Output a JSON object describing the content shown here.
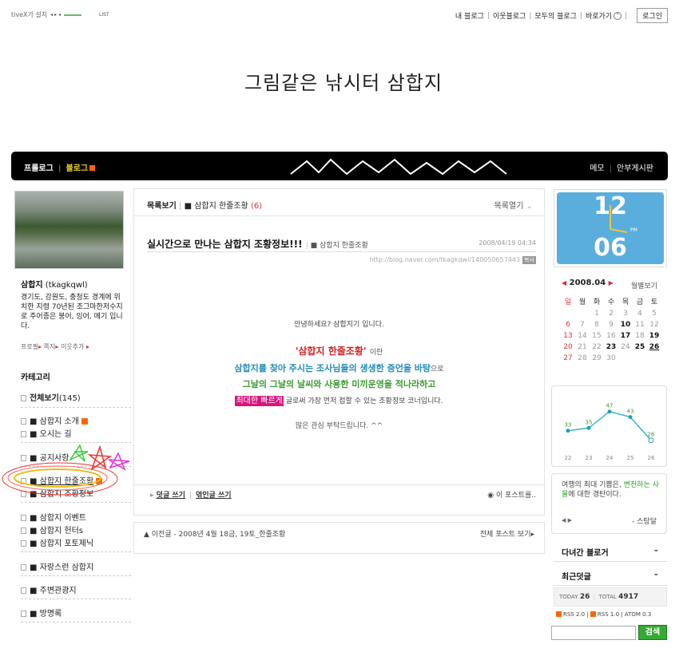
{
  "topbar": {
    "activex_text": "tiveX가 설치",
    "install_link": "설치",
    "player_list": "LIST",
    "links": [
      "내 블로그",
      "이웃블로그",
      "모두의 블로그",
      "바로가기"
    ],
    "login": "로그인"
  },
  "blog_title": "그림같은 낚시터 삼합지",
  "nav": {
    "prologue": "프롤로그",
    "blog": "블로그",
    "memo": "메모",
    "board": "안부게시판"
  },
  "profile": {
    "name": "삼합지",
    "id": "(tkagkqwl)",
    "description": "경기도, 강원도, 충청도 경계에 위치한 지령 70년된 조그마한저수지로 주어종은 붕어, 잉어, 메기 입니다.",
    "links": [
      "프로필",
      "쪽지",
      "이웃추가"
    ]
  },
  "categories": {
    "title": "카테고리",
    "all": "전체보기",
    "all_count": "(145)",
    "items": [
      "■ 삼합지 소개",
      "■ 오시는 길",
      "■ 공지사항",
      "■ 삼합지 한줄조황",
      "■ 삼합지 조황정보",
      "■ 삼합지 이벤트",
      "■ 삼합지 헌터s",
      "■ 삼합지 포토제닉",
      "■ 자랑스런 삼합지",
      "■ 주변관광지",
      "■ 방명록"
    ]
  },
  "listbar": {
    "view_list": "목록보기",
    "category": "■ 삼합지 한줄조황",
    "count": "(6)",
    "open_list": "목록열기"
  },
  "post": {
    "title": "실시간으로 만나는 삼합지 조황정보!!!",
    "category": "■ 삼합지 한줄조황",
    "date": "2008/04/19 04:34",
    "url": "http://blog.naver.com/tkagkqwl/140050657443",
    "copy": "복사",
    "greeting": "안녕하세요? 삼합지기 입니다.",
    "headline": "'삼합지 한줄조황'",
    "headline_suffix": "이란",
    "line3": "삼합지를 찾아 주시는 조사님들의 생생한 증언을 바탕",
    "line3_suffix": "으로",
    "line4": "그날의 그날의 날씨와 사용한 미끼운영을 적나라하고",
    "line5_highlight": "최대한 빠르게",
    "line5_rest": " 글로써 가장 먼저 접할 수 있는 조황정보 코너입니다.",
    "closing": "많은 관심 부탁드립니다. ^^",
    "comment_write": "덧글 쓰기",
    "trackback_write": "엮인글 쓰기",
    "this_post": "이 포스트를.."
  },
  "postnav": {
    "prev": "▲ 이전글 - 2008년 4월 18금, 19토_한줄조황",
    "all": "전체 포스트 보기"
  },
  "clock": {
    "hour": "12",
    "minute": "06",
    "ampm": "PM"
  },
  "calendar": {
    "month": "2008.04",
    "view": "월별보기",
    "weekdays": [
      "일",
      "월",
      "화",
      "수",
      "목",
      "금",
      "토"
    ],
    "days": [
      "",
      "",
      "1",
      "2",
      "3",
      "4",
      "5",
      "6",
      "7",
      "8",
      "9",
      "10",
      "11",
      "12",
      "13",
      "14",
      "15",
      "16",
      "17",
      "18",
      "19",
      "20",
      "21",
      "22",
      "23",
      "24",
      "25",
      "26",
      "27",
      "28",
      "29",
      "30",
      "",
      "",
      ""
    ]
  },
  "visitor_graph": {
    "x": [
      "22",
      "23",
      "24",
      "25",
      "26"
    ],
    "values": [
      33,
      35,
      47,
      43,
      26
    ]
  },
  "quote": {
    "text_a": "여행의 최대 기쁨은, ",
    "text_b": "변천하는 사물",
    "text_c": "에 대한 경탄이다.",
    "author": "- 스탕달"
  },
  "right_sections": {
    "recent_visitors": "다녀간 블로거",
    "recent_comments": "최근덧글"
  },
  "visits": {
    "today_label": "TODAY",
    "today": "26",
    "total_label": "TOTAL",
    "total": "4917"
  },
  "feeds": [
    "RSS 2.0",
    "RSS 1.0",
    "ATOM 0.3"
  ],
  "search": {
    "button": "검색",
    "placeholder": ""
  }
}
